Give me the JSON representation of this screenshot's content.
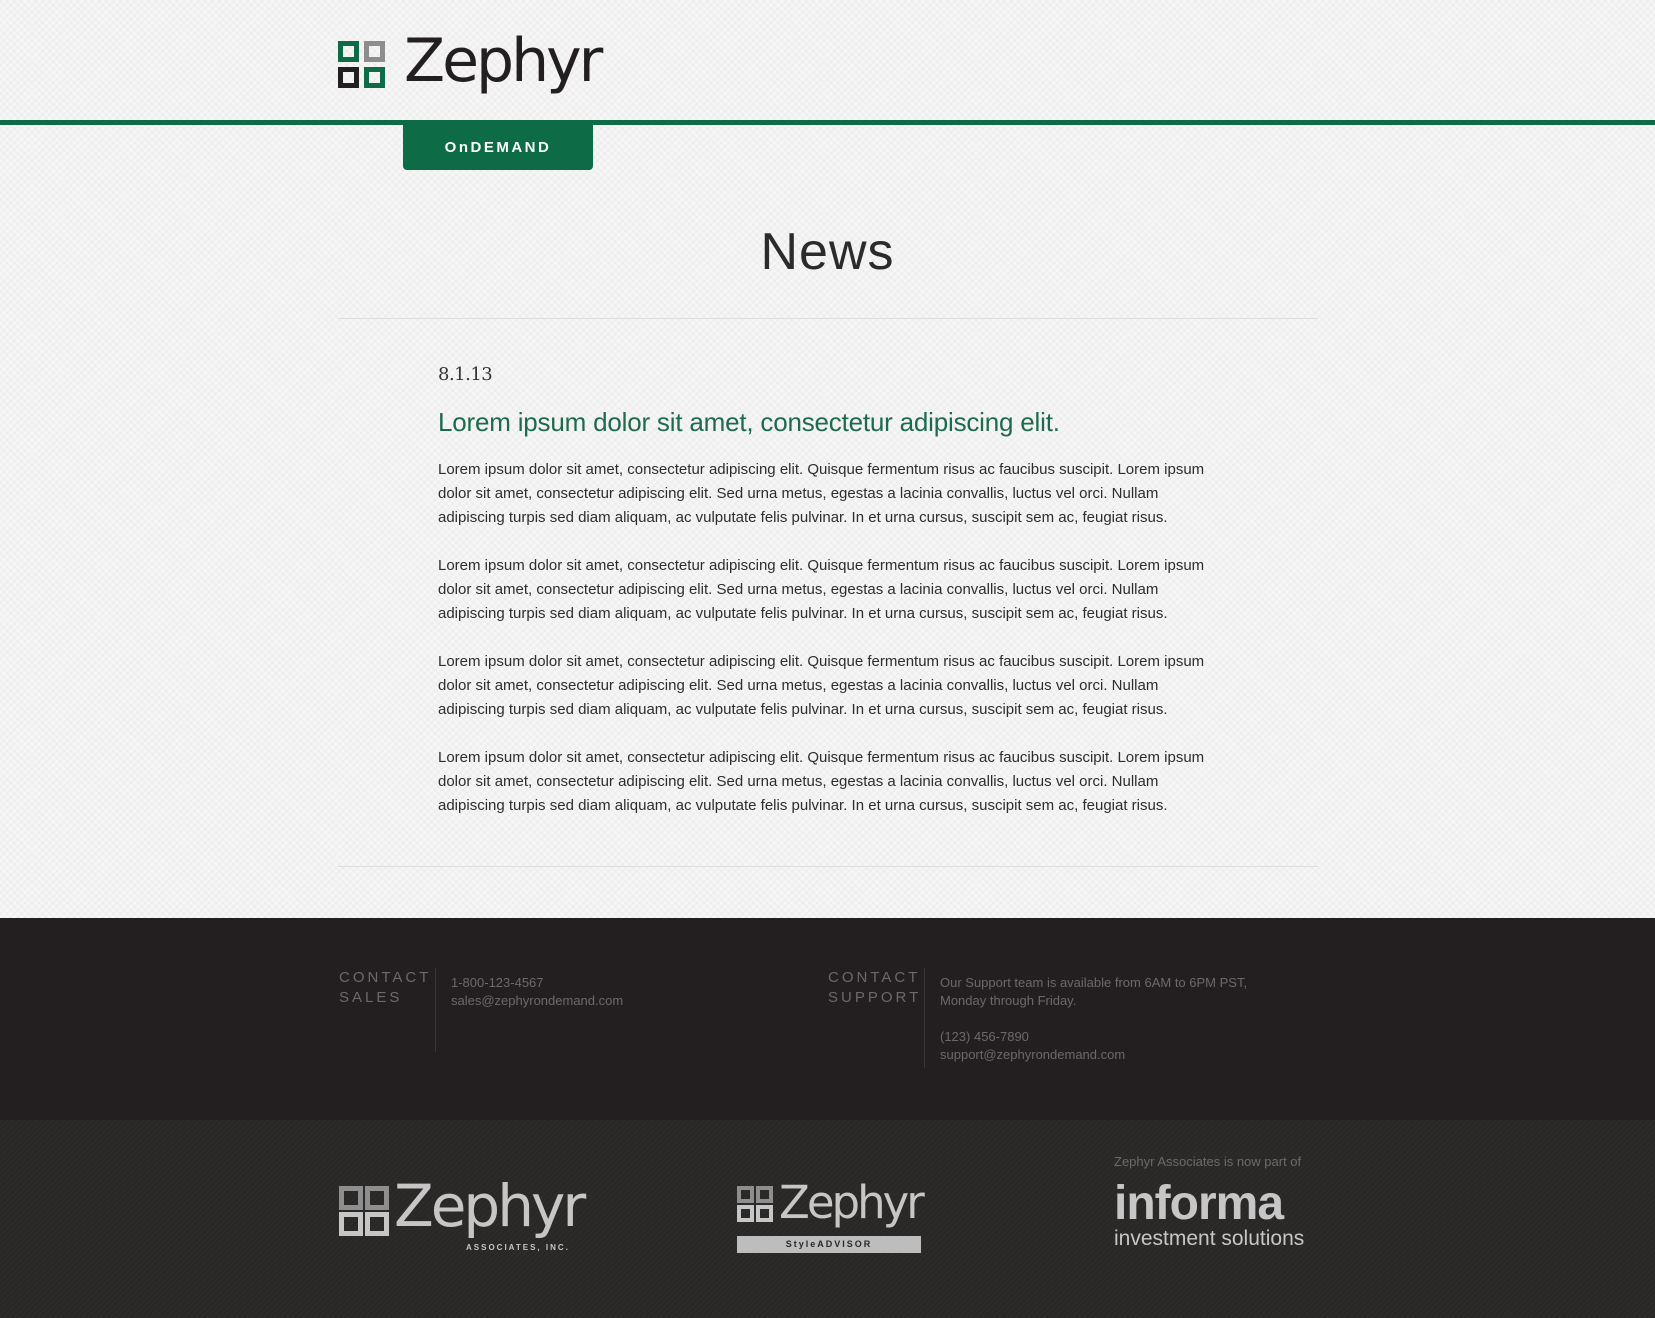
{
  "header": {
    "logo_text": "Zephyr",
    "nav": {
      "ondemand_label": "OnDEMAND"
    }
  },
  "main": {
    "title": "News",
    "article": {
      "date": "8.1.13",
      "headline": "Lorem ipsum dolor sit amet, consectetur adipiscing elit.",
      "paragraphs": [
        "Lorem ipsum dolor sit amet, consectetur adipiscing elit. Quisque fermentum risus ac faucibus suscipit. Lorem ipsum dolor sit amet, consectetur adipiscing elit. Sed urna metus, egestas a lacinia convallis, luctus vel orci. Nullam adipiscing turpis sed diam aliquam, ac vulputate felis pulvinar. In et urna cursus, suscipit sem ac, feugiat risus.",
        "Lorem ipsum dolor sit amet, consectetur adipiscing elit. Quisque fermentum risus ac faucibus suscipit. Lorem ipsum dolor sit amet, consectetur adipiscing elit. Sed urna metus, egestas a lacinia convallis, luctus vel orci. Nullam adipiscing turpis sed diam aliquam, ac vulputate felis pulvinar. In et urna cursus, suscipit sem ac, feugiat risus.",
        "Lorem ipsum dolor sit amet, consectetur adipiscing elit. Quisque fermentum risus ac faucibus suscipit. Lorem ipsum dolor sit amet, consectetur adipiscing elit. Sed urna metus, egestas a lacinia convallis, luctus vel orci. Nullam adipiscing turpis sed diam aliquam, ac vulputate felis pulvinar. In et urna cursus, suscipit sem ac, feugiat risus.",
        "Lorem ipsum dolor sit amet, consectetur adipiscing elit. Quisque fermentum risus ac faucibus suscipit. Lorem ipsum dolor sit amet, consectetur adipiscing elit. Sed urna metus, egestas a lacinia convallis, luctus vel orci. Nullam adipiscing turpis sed diam aliquam, ac vulputate felis pulvinar. In et urna cursus, suscipit sem ac, feugiat risus."
      ]
    }
  },
  "footer": {
    "contact_sales": {
      "label": "CONTACT\nSALES",
      "phone": "1-800-123-4567",
      "email": "sales@zephyrondemand.com"
    },
    "contact_support": {
      "label": "CONTACT\nSUPPORT",
      "hours": "Our Support team is available from 6AM to 6PM PST,\nMonday through Friday.",
      "phone": "(123) 456-7890",
      "email": "support@zephyrondemand.com"
    },
    "brands": {
      "zephyr_associates": {
        "name": "Zephyr",
        "tagline": "ASSOCIATES, INC."
      },
      "style_advisor": {
        "name": "Zephyr",
        "tagline": "StyleADVISOR"
      },
      "informa": {
        "intro": "Zephyr Associates is now part of",
        "name": "informa",
        "tagline": "investment solutions"
      }
    }
  },
  "colors": {
    "brand_green": "#0d6b45",
    "headline_green": "#1d6b4e",
    "footer_dark": "#231f20",
    "footer_brands": "#2a2727"
  },
  "icons": {
    "logo": "zephyr-squares-logo-icon"
  }
}
